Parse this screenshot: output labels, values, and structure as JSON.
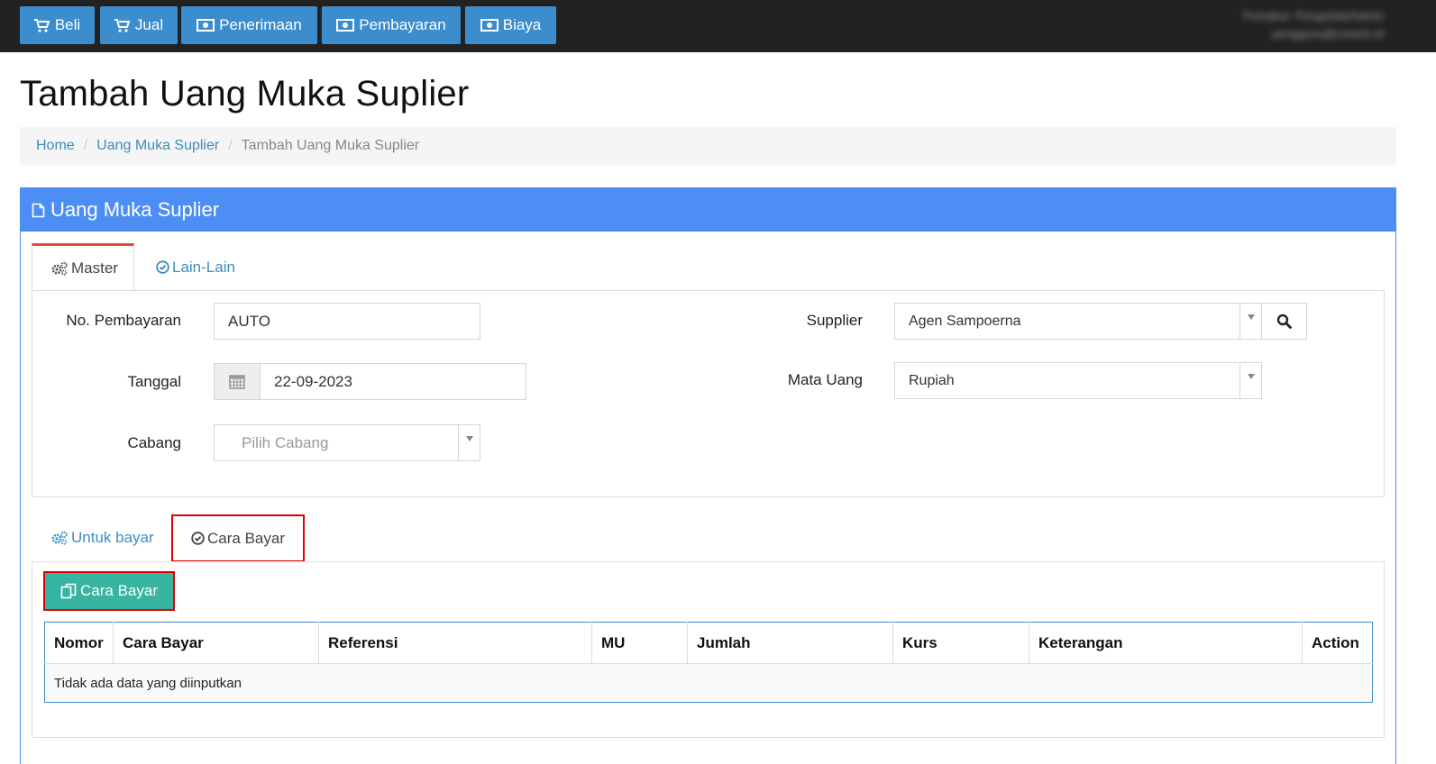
{
  "topnav": {
    "beli": "Beli",
    "jual": "Jual",
    "penerimaan": "Penerimaan",
    "pembayaran": "Pembayaran",
    "biaya": "Biaya",
    "user_line1": "Pemakai: Pengelola/Admin",
    "user_line2": "pengguna@contoh.id"
  },
  "page": {
    "title": "Tambah Uang Muka Suplier"
  },
  "breadcrumb": {
    "home": "Home",
    "parent": "Uang Muka Suplier",
    "current": "Tambah Uang Muka Suplier",
    "separator": "/"
  },
  "panel": {
    "title": "Uang Muka Suplier"
  },
  "tabs1": {
    "master": "Master",
    "lain": "Lain-Lain"
  },
  "form": {
    "no_pembayaran_label": "No. Pembayaran",
    "no_pembayaran_value": "AUTO",
    "tanggal_label": "Tanggal",
    "tanggal_value": "22-09-2023",
    "cabang_label": "Cabang",
    "cabang_placeholder": "Pilih Cabang",
    "supplier_label": "Supplier",
    "supplier_value": "Agen Sampoerna",
    "mata_uang_label": "Mata Uang",
    "mata_uang_value": "Rupiah"
  },
  "tabs2": {
    "untuk_bayar": "Untuk bayar",
    "cara_bayar": "Cara Bayar"
  },
  "cara_bayar_button": "Cara Bayar",
  "table": {
    "headers": {
      "nomor": "Nomor",
      "cara_bayar": "Cara Bayar",
      "referensi": "Referensi",
      "mu": "MU",
      "jumlah": "Jumlah",
      "kurs": "Kurs",
      "keterangan": "Keterangan",
      "action": "Action"
    },
    "empty": "Tidak ada data yang diinputkan"
  },
  "colors": {
    "topbar": "#222222",
    "nav_button": "#3c8dcd",
    "panel_header": "#4d8ef5",
    "link": "#3c8dbc",
    "tab_active_border": "#dd4b39",
    "highlight": "#e00000",
    "green_button": "#37b4a2"
  }
}
